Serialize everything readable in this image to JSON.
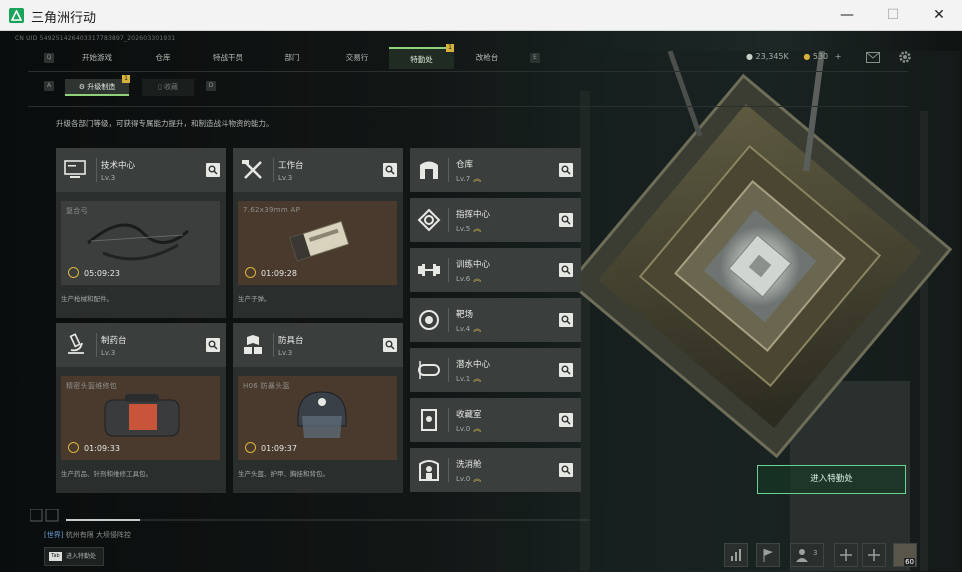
{
  "window": {
    "title": "三角洲行动",
    "minimize": "—",
    "maximize": "☐",
    "close": "✕"
  },
  "uid": "CN UID 549251426403317783897_202603301931",
  "nav": {
    "left_key": "Q",
    "right_key": "E",
    "tabs": [
      {
        "label": "开始游戏"
      },
      {
        "label": "仓库"
      },
      {
        "label": "特战干员"
      },
      {
        "label": "部门"
      },
      {
        "label": "交易行"
      },
      {
        "label": "特勤处",
        "active": true,
        "badge": "1"
      },
      {
        "label": "改枪台"
      }
    ]
  },
  "currency": {
    "coins": "23,345K",
    "tickets": "530",
    "plus": "+"
  },
  "subtabs": {
    "left_key": "A",
    "right_key": "D",
    "upgrade": {
      "label": "升级制造",
      "badge": "1"
    },
    "collect": {
      "label": "收藏"
    }
  },
  "description": "升级各部门等级，可获得专属能力提升，和制造战斗物资的能力。",
  "workshops": [
    {
      "name": "技术中心",
      "level": "Lv.3",
      "product": "复合弓",
      "timer": "05:09:23",
      "desc": "生产枪械和配件。",
      "icon": "computer-icon"
    },
    {
      "name": "工作台",
      "level": "Lv.3",
      "product": "7.62x39mm AP",
      "timer": "01:09:28",
      "desc": "生产子弹。",
      "icon": "tools-icon"
    },
    {
      "name": "制药台",
      "level": "Lv.3",
      "product": "精密头盔维修包",
      "timer": "01:09:33",
      "desc": "生产药品、针剂和维修工具包。",
      "icon": "microscope-icon"
    },
    {
      "name": "防具台",
      "level": "Lv.3",
      "product": "H06 防暴头盔",
      "timer": "01:09:37",
      "desc": "生产头盔、护甲、胸挂和背包。",
      "icon": "armor-icon"
    }
  ],
  "facilities": [
    {
      "name": "仓库",
      "level": "Lv.7",
      "icon": "warehouse-icon"
    },
    {
      "name": "指挥中心",
      "level": "Lv.5",
      "icon": "command-icon"
    },
    {
      "name": "训练中心",
      "level": "Lv.6",
      "icon": "dumbbell-icon"
    },
    {
      "name": "靶场",
      "level": "Lv.4",
      "icon": "target-icon"
    },
    {
      "name": "潜水中心",
      "level": "Lv.1",
      "icon": "diving-icon"
    },
    {
      "name": "收藏室",
      "level": "Lv.0",
      "icon": "collection-icon"
    },
    {
      "name": "洗消舱",
      "level": "Lv.0",
      "icon": "decon-icon"
    }
  ],
  "up_glyph": "︽",
  "enter_button": "进入特勤处",
  "chat": {
    "channel": "[世界]",
    "location": "杭州有限",
    "text": "大坝侵阵控"
  },
  "chat_tab": {
    "key": "Tab",
    "label": "进入特勤处"
  },
  "friends_count": "3",
  "avatar_level": "60",
  "colors": {
    "accent_green": "#8ed27a",
    "gold": "#d7b23a",
    "panel": "#3a3f3e"
  }
}
